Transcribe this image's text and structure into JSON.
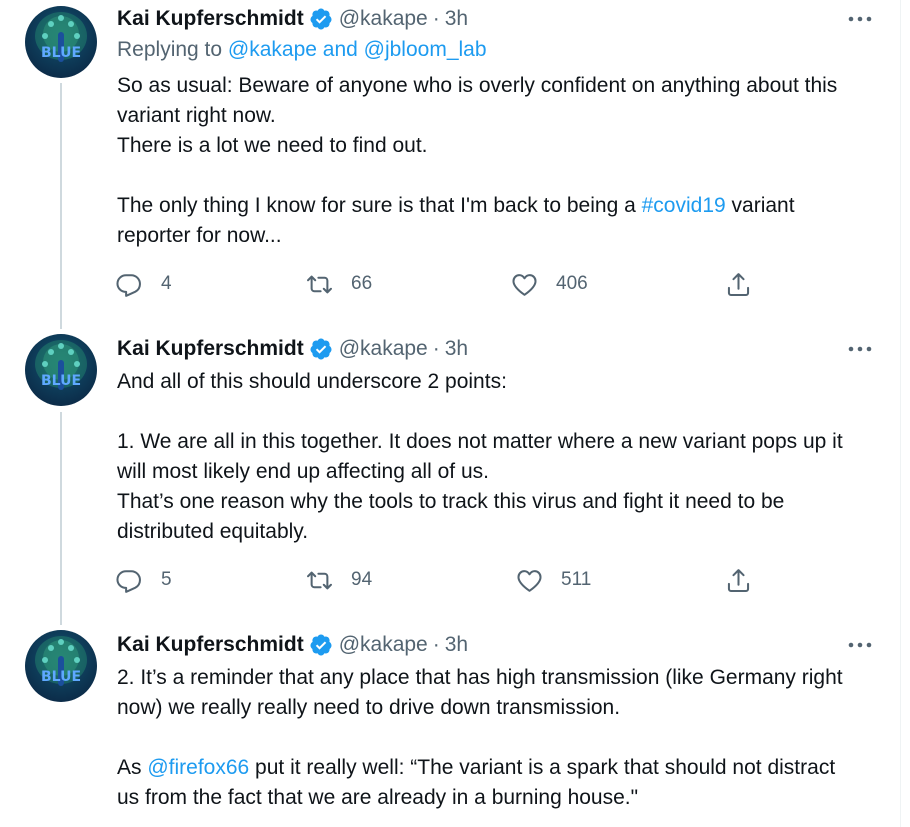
{
  "tweets": [
    {
      "name": "Kai Kupferschmidt",
      "handle": "@kakape",
      "separator": "·",
      "time": "3h",
      "replying_prefix": "Replying to ",
      "replying_to": "@kakape and @jbloom_lab",
      "body": {
        "line1": "So as usual: Beware of anyone who is overly confident on anything about this variant right now.",
        "line2": "There is a lot we need to find out.",
        "line3_pre": "The only thing I know for sure is that I'm back to being a ",
        "hashtag": "#covid19",
        "line3_post": " variant reporter for now..."
      },
      "replies": "4",
      "retweets": "66",
      "likes": "406"
    },
    {
      "name": "Kai Kupferschmidt",
      "handle": "@kakape",
      "separator": "·",
      "time": "3h",
      "body": {
        "line1": "And all of this should underscore 2 points:",
        "line2": "1. We are all in this together. It does not matter where a new variant pops up it will most likely end up affecting all of us.",
        "line3": "That’s one reason why the tools to track this virus and fight it need to be distributed equitably."
      },
      "replies": "5",
      "retweets": "94",
      "likes": "511"
    },
    {
      "name": "Kai Kupferschmidt",
      "handle": "@kakape",
      "separator": "·",
      "time": "3h",
      "body": {
        "line1": "2. It’s a reminder that any place that has high transmission (like Germany right now) we really really need to drive down transmission.",
        "line2_pre": "As ",
        "mention": "@firefox66",
        "line2_post": " put it really well: “The variant is a spark that should not distract us from the fact that we are already in a burning house.\""
      }
    }
  ],
  "avatar_text": "BLUE",
  "icons": {
    "verified": "verified-badge-icon",
    "more": "more-options-icon",
    "reply": "reply-icon",
    "retweet": "retweet-icon",
    "like": "heart-icon",
    "share": "share-icon"
  },
  "colors": {
    "link": "#1d9bf0",
    "secondary_text": "#536471",
    "primary_text": "#0f1419",
    "thread_line": "#cfd9de"
  }
}
